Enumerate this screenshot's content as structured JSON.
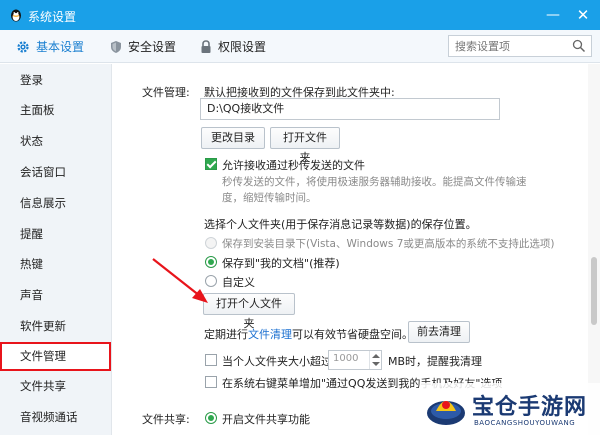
{
  "window": {
    "title": "系统设置",
    "minimize": "—",
    "close": "✕"
  },
  "tabs": [
    {
      "label": "基本设置",
      "icon": "gear-icon",
      "active": true
    },
    {
      "label": "安全设置",
      "icon": "shield-icon",
      "active": false
    },
    {
      "label": "权限设置",
      "icon": "lock-icon",
      "active": false
    }
  ],
  "search": {
    "placeholder": "搜索设置项"
  },
  "sidebar": {
    "items": [
      {
        "label": "登录"
      },
      {
        "label": "主面板"
      },
      {
        "label": "状态"
      },
      {
        "label": "会话窗口"
      },
      {
        "label": "信息展示"
      },
      {
        "label": "提醒"
      },
      {
        "label": "热键"
      },
      {
        "label": "声音"
      },
      {
        "label": "软件更新"
      },
      {
        "label": "文件管理",
        "active": true
      },
      {
        "label": "文件共享"
      },
      {
        "label": "音视频通话"
      }
    ]
  },
  "file_manage": {
    "section_label": "文件管理:",
    "desc": "默认把接收到的文件保存到此文件夹中:",
    "path_value": "D:\\QQ接收文件",
    "change_dir_button": "更改目录",
    "open_folder_button": "打开文件夹",
    "allow_transfer_label": "允许接收通过秒传发送的文件",
    "allow_transfer_checked": true,
    "hint_line1": "秒传发送的文件，将使用极速服务器辅助接收。能提高文件传输速",
    "hint_line2": "度，缩短传输时间。",
    "personal_folder_title": "选择个人文件夹(用于保存消息记录等数据)的保存位置。",
    "options": [
      {
        "label": "保存到安装目录下(Vista、Windows 7或更高版本的系统不支持此选项)",
        "state": "disabled"
      },
      {
        "label": "保存到\"我的文档\"(推荐)",
        "state": "checked"
      },
      {
        "label": "自定义",
        "state": "unchecked"
      }
    ],
    "open_personal_folder_button": "打开个人文件夹",
    "cleanup_prefix": "定期进行",
    "cleanup_link": "文件清理",
    "cleanup_suffix": "可以有效节省硬盘空间。",
    "cleanup_button": "前去清理",
    "size_warn_prefix": "当个人文件夹大小超过",
    "size_value": "1000",
    "size_warn_suffix": "MB时，提醒我清理",
    "context_menu_label": "在系统右键菜单增加\"通过QQ发送到我的手机及好友\"选项"
  },
  "file_share": {
    "section_label": "文件共享:",
    "enable_label": "开启文件共享功能"
  },
  "watermark": {
    "main": "宝仓手游网",
    "sub": "BAOCANGSHOUYOUWANG"
  },
  "colors": {
    "titlebar": "#1aa0e8",
    "active_tab": "#1a7fd0",
    "highlight_border": "#e8141b",
    "annotation_arrow": "#e8141b",
    "check_green": "#2fa84f"
  }
}
